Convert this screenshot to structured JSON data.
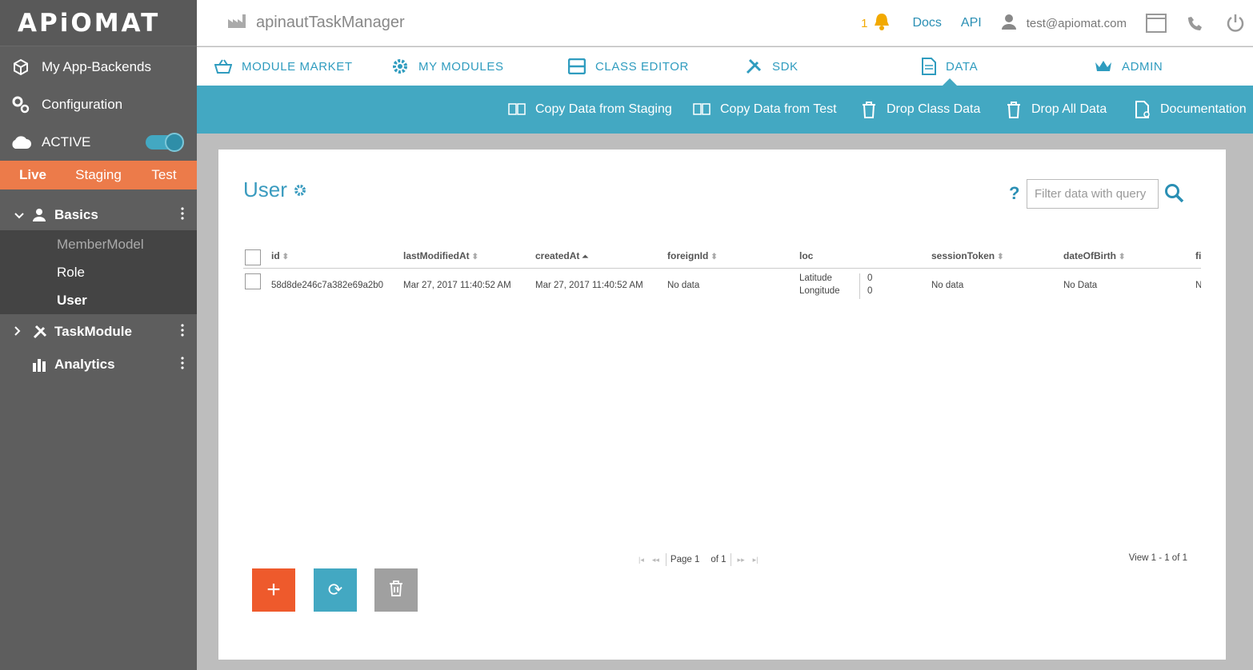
{
  "sidebar": {
    "logo": "APiOMAT",
    "items": [
      {
        "label": "My App-Backends",
        "icon": "cube-icon"
      },
      {
        "label": "Configuration",
        "icon": "gears-icon"
      }
    ],
    "status": {
      "label": "ACTIVE",
      "icon": "cloud-icon",
      "toggle_on": true
    },
    "env_tabs": [
      {
        "label": "Live",
        "selected": true
      },
      {
        "label": "Staging",
        "selected": false
      },
      {
        "label": "Test",
        "selected": false
      }
    ],
    "groups": [
      {
        "label": "Basics",
        "icon": "user-icon",
        "expanded": true,
        "children": [
          {
            "label": "MemberModel",
            "state": "dim"
          },
          {
            "label": "Role",
            "state": "normal"
          },
          {
            "label": "User",
            "state": "selected"
          }
        ]
      },
      {
        "label": "TaskModule",
        "icon": "tools-icon",
        "expanded": false
      },
      {
        "label": "Analytics",
        "icon": "analytics-icon",
        "expanded": false
      }
    ]
  },
  "header": {
    "app_name": "apinautTaskManager",
    "notification_count": "1",
    "docs": "Docs",
    "api": "API",
    "user_email": "test@apiomat.com"
  },
  "modules": [
    {
      "label": "MODULE MARKET",
      "icon": "basket-icon"
    },
    {
      "label": "MY MODULES",
      "icon": "gear-icon"
    },
    {
      "label": "CLASS EDITOR",
      "icon": "class-editor-icon"
    },
    {
      "label": "SDK",
      "icon": "tools-icon"
    },
    {
      "label": "DATA",
      "icon": "document-icon",
      "active": true
    },
    {
      "label": "ADMIN",
      "icon": "crown-icon"
    }
  ],
  "actions": [
    {
      "label": "Copy Data from Staging",
      "icon": "copy-icon"
    },
    {
      "label": "Copy Data from Test",
      "icon": "copy-icon"
    },
    {
      "label": "Drop Class Data",
      "icon": "trash-icon"
    },
    {
      "label": "Drop All Data",
      "icon": "trash-icon"
    },
    {
      "label": "Documentation",
      "icon": "doc-icon"
    }
  ],
  "content": {
    "title": "User",
    "help": "?",
    "filter_placeholder": "Filter data with query",
    "columns": [
      "id",
      "lastModifiedAt",
      "createdAt",
      "foreignId",
      "loc",
      "sessionToken",
      "dateOfBirth",
      "fi"
    ],
    "row": {
      "id": "58d8de246c7a382e69a2b0",
      "lastModifiedAt": "Mar 27, 2017 11:40:52 AM",
      "createdAt": "Mar 27, 2017 11:40:52 AM",
      "foreignId": "No data",
      "loc_lat_label": "Latitude",
      "loc_lat_value": "0",
      "loc_lon_label": "Longitude",
      "loc_lon_value": "0",
      "sessionToken": "No data",
      "dateOfBirth": "No Data",
      "fi": "N"
    },
    "pager": {
      "page_label": "Page 1",
      "of_label": "of 1"
    },
    "view_info": "View 1 - 1 of 1",
    "buttons": {
      "add": "+",
      "refresh": "⟳"
    }
  }
}
